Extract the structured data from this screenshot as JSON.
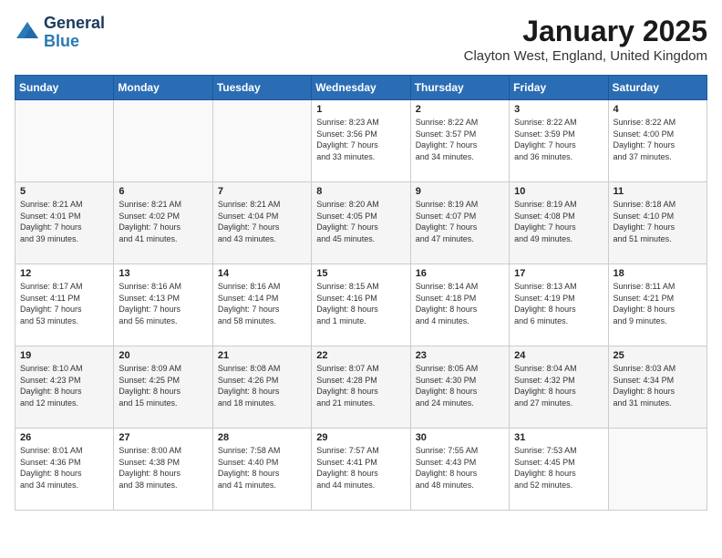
{
  "logo": {
    "line1": "General",
    "line2": "Blue"
  },
  "title": "January 2025",
  "location": "Clayton West, England, United Kingdom",
  "weekdays": [
    "Sunday",
    "Monday",
    "Tuesday",
    "Wednesday",
    "Thursday",
    "Friday",
    "Saturday"
  ],
  "weeks": [
    [
      {
        "day": "",
        "info": ""
      },
      {
        "day": "",
        "info": ""
      },
      {
        "day": "",
        "info": ""
      },
      {
        "day": "1",
        "info": "Sunrise: 8:23 AM\nSunset: 3:56 PM\nDaylight: 7 hours\nand 33 minutes."
      },
      {
        "day": "2",
        "info": "Sunrise: 8:22 AM\nSunset: 3:57 PM\nDaylight: 7 hours\nand 34 minutes."
      },
      {
        "day": "3",
        "info": "Sunrise: 8:22 AM\nSunset: 3:59 PM\nDaylight: 7 hours\nand 36 minutes."
      },
      {
        "day": "4",
        "info": "Sunrise: 8:22 AM\nSunset: 4:00 PM\nDaylight: 7 hours\nand 37 minutes."
      }
    ],
    [
      {
        "day": "5",
        "info": "Sunrise: 8:21 AM\nSunset: 4:01 PM\nDaylight: 7 hours\nand 39 minutes."
      },
      {
        "day": "6",
        "info": "Sunrise: 8:21 AM\nSunset: 4:02 PM\nDaylight: 7 hours\nand 41 minutes."
      },
      {
        "day": "7",
        "info": "Sunrise: 8:21 AM\nSunset: 4:04 PM\nDaylight: 7 hours\nand 43 minutes."
      },
      {
        "day": "8",
        "info": "Sunrise: 8:20 AM\nSunset: 4:05 PM\nDaylight: 7 hours\nand 45 minutes."
      },
      {
        "day": "9",
        "info": "Sunrise: 8:19 AM\nSunset: 4:07 PM\nDaylight: 7 hours\nand 47 minutes."
      },
      {
        "day": "10",
        "info": "Sunrise: 8:19 AM\nSunset: 4:08 PM\nDaylight: 7 hours\nand 49 minutes."
      },
      {
        "day": "11",
        "info": "Sunrise: 8:18 AM\nSunset: 4:10 PM\nDaylight: 7 hours\nand 51 minutes."
      }
    ],
    [
      {
        "day": "12",
        "info": "Sunrise: 8:17 AM\nSunset: 4:11 PM\nDaylight: 7 hours\nand 53 minutes."
      },
      {
        "day": "13",
        "info": "Sunrise: 8:16 AM\nSunset: 4:13 PM\nDaylight: 7 hours\nand 56 minutes."
      },
      {
        "day": "14",
        "info": "Sunrise: 8:16 AM\nSunset: 4:14 PM\nDaylight: 7 hours\nand 58 minutes."
      },
      {
        "day": "15",
        "info": "Sunrise: 8:15 AM\nSunset: 4:16 PM\nDaylight: 8 hours\nand 1 minute."
      },
      {
        "day": "16",
        "info": "Sunrise: 8:14 AM\nSunset: 4:18 PM\nDaylight: 8 hours\nand 4 minutes."
      },
      {
        "day": "17",
        "info": "Sunrise: 8:13 AM\nSunset: 4:19 PM\nDaylight: 8 hours\nand 6 minutes."
      },
      {
        "day": "18",
        "info": "Sunrise: 8:11 AM\nSunset: 4:21 PM\nDaylight: 8 hours\nand 9 minutes."
      }
    ],
    [
      {
        "day": "19",
        "info": "Sunrise: 8:10 AM\nSunset: 4:23 PM\nDaylight: 8 hours\nand 12 minutes."
      },
      {
        "day": "20",
        "info": "Sunrise: 8:09 AM\nSunset: 4:25 PM\nDaylight: 8 hours\nand 15 minutes."
      },
      {
        "day": "21",
        "info": "Sunrise: 8:08 AM\nSunset: 4:26 PM\nDaylight: 8 hours\nand 18 minutes."
      },
      {
        "day": "22",
        "info": "Sunrise: 8:07 AM\nSunset: 4:28 PM\nDaylight: 8 hours\nand 21 minutes."
      },
      {
        "day": "23",
        "info": "Sunrise: 8:05 AM\nSunset: 4:30 PM\nDaylight: 8 hours\nand 24 minutes."
      },
      {
        "day": "24",
        "info": "Sunrise: 8:04 AM\nSunset: 4:32 PM\nDaylight: 8 hours\nand 27 minutes."
      },
      {
        "day": "25",
        "info": "Sunrise: 8:03 AM\nSunset: 4:34 PM\nDaylight: 8 hours\nand 31 minutes."
      }
    ],
    [
      {
        "day": "26",
        "info": "Sunrise: 8:01 AM\nSunset: 4:36 PM\nDaylight: 8 hours\nand 34 minutes."
      },
      {
        "day": "27",
        "info": "Sunrise: 8:00 AM\nSunset: 4:38 PM\nDaylight: 8 hours\nand 38 minutes."
      },
      {
        "day": "28",
        "info": "Sunrise: 7:58 AM\nSunset: 4:40 PM\nDaylight: 8 hours\nand 41 minutes."
      },
      {
        "day": "29",
        "info": "Sunrise: 7:57 AM\nSunset: 4:41 PM\nDaylight: 8 hours\nand 44 minutes."
      },
      {
        "day": "30",
        "info": "Sunrise: 7:55 AM\nSunset: 4:43 PM\nDaylight: 8 hours\nand 48 minutes."
      },
      {
        "day": "31",
        "info": "Sunrise: 7:53 AM\nSunset: 4:45 PM\nDaylight: 8 hours\nand 52 minutes."
      },
      {
        "day": "",
        "info": ""
      }
    ]
  ]
}
